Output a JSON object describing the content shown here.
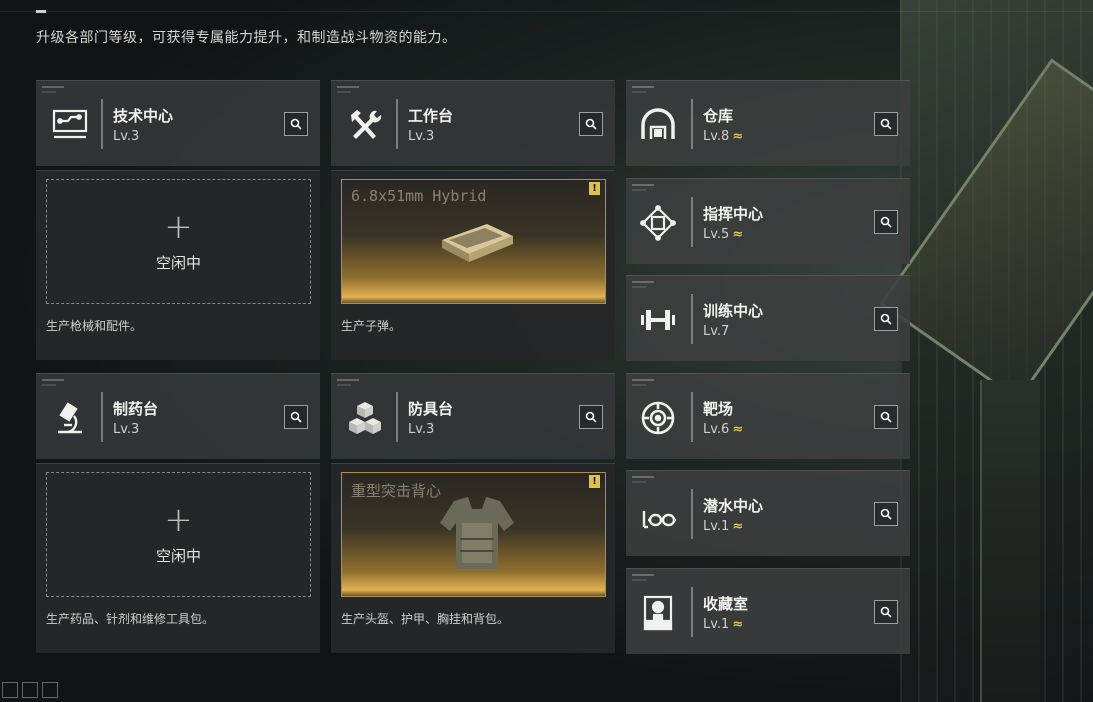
{
  "subtitle": "升级各部门等级，可获得专属能力提升，和制造战斗物资的能力。",
  "colors": {
    "accent_gold": "#e8c64a",
    "panel": "#343739"
  },
  "departments": {
    "tech": {
      "name": "技术中心",
      "level": "Lv.3",
      "icon": "tech-center-icon",
      "idle": "空闲中",
      "desc": "生产枪械和配件。"
    },
    "workbench": {
      "name": "工作台",
      "level": "Lv.3",
      "icon": "tools-icon",
      "product": "6.8x51mm Hybrid",
      "desc": "生产子弹。"
    },
    "pharmacy": {
      "name": "制药台",
      "level": "Lv.3",
      "icon": "microscope-icon",
      "idle": "空闲中",
      "desc": "生产药品、针剂和维修工具包。"
    },
    "armor": {
      "name": "防具台",
      "level": "Lv.3",
      "icon": "cubes-icon",
      "product": "重型突击背心",
      "desc": "生产头盔、护甲、胸挂和背包。"
    }
  },
  "right_list": [
    {
      "name": "仓库",
      "level": "Lv.8",
      "upgradable": true,
      "icon": "warehouse-icon"
    },
    {
      "name": "指挥中心",
      "level": "Lv.5",
      "upgradable": true,
      "icon": "chip-icon"
    },
    {
      "name": "训练中心",
      "level": "Lv.7",
      "upgradable": false,
      "icon": "dumbbell-icon"
    },
    {
      "name": "靶场",
      "level": "Lv.6",
      "upgradable": true,
      "icon": "target-icon"
    },
    {
      "name": "潜水中心",
      "level": "Lv.1",
      "upgradable": true,
      "icon": "diving-mask-icon"
    },
    {
      "name": "收藏室",
      "level": "Lv.1",
      "upgradable": true,
      "icon": "display-case-icon"
    }
  ],
  "upgrade_glyph": "≈",
  "warn_glyph": "!",
  "plus_glyph": "+"
}
